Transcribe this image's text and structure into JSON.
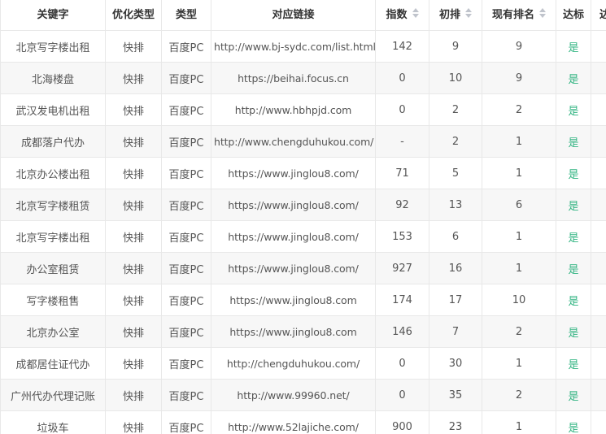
{
  "table": {
    "headers": {
      "keyword": "关键字",
      "opt_type": "优化类型",
      "type": "类型",
      "url": "对应链接",
      "index": "指数",
      "initial_rank": "初排",
      "current_rank": "现有排名",
      "reached": "达标",
      "extra": "达"
    },
    "rows": [
      {
        "keyword": "北京写字楼出租",
        "opt_type": "快排",
        "type": "百度PC",
        "url": "http://www.bj-sydc.com/list.html",
        "index": "142",
        "initial_rank": "9",
        "current_rank": "9",
        "reached": "是"
      },
      {
        "keyword": "北海楼盘",
        "opt_type": "快排",
        "type": "百度PC",
        "url": "https://beihai.focus.cn",
        "index": "0",
        "initial_rank": "10",
        "current_rank": "9",
        "reached": "是"
      },
      {
        "keyword": "武汉发电机出租",
        "opt_type": "快排",
        "type": "百度PC",
        "url": "http://www.hbhpjd.com",
        "index": "0",
        "initial_rank": "2",
        "current_rank": "2",
        "reached": "是"
      },
      {
        "keyword": "成都落户代办",
        "opt_type": "快排",
        "type": "百度PC",
        "url": "http://www.chengduhukou.com/",
        "index": "-",
        "initial_rank": "2",
        "current_rank": "1",
        "reached": "是"
      },
      {
        "keyword": "北京办公楼出租",
        "opt_type": "快排",
        "type": "百度PC",
        "url": "https://www.jinglou8.com/",
        "index": "71",
        "initial_rank": "5",
        "current_rank": "1",
        "reached": "是"
      },
      {
        "keyword": "北京写字楼租赁",
        "opt_type": "快排",
        "type": "百度PC",
        "url": "https://www.jinglou8.com/",
        "index": "92",
        "initial_rank": "13",
        "current_rank": "6",
        "reached": "是"
      },
      {
        "keyword": "北京写字楼出租",
        "opt_type": "快排",
        "type": "百度PC",
        "url": "https://www.jinglou8.com/",
        "index": "153",
        "initial_rank": "6",
        "current_rank": "1",
        "reached": "是"
      },
      {
        "keyword": "办公室租赁",
        "opt_type": "快排",
        "type": "百度PC",
        "url": "https://www.jinglou8.com/",
        "index": "927",
        "initial_rank": "16",
        "current_rank": "1",
        "reached": "是"
      },
      {
        "keyword": "写字楼租售",
        "opt_type": "快排",
        "type": "百度PC",
        "url": "https://www.jinglou8.com",
        "index": "174",
        "initial_rank": "17",
        "current_rank": "10",
        "reached": "是"
      },
      {
        "keyword": "北京办公室",
        "opt_type": "快排",
        "type": "百度PC",
        "url": "https://www.jinglou8.com",
        "index": "146",
        "initial_rank": "7",
        "current_rank": "2",
        "reached": "是"
      },
      {
        "keyword": "成都居住证代办",
        "opt_type": "快排",
        "type": "百度PC",
        "url": "http://chengduhukou.com/",
        "index": "0",
        "initial_rank": "30",
        "current_rank": "1",
        "reached": "是"
      },
      {
        "keyword": "广州代办代理记账",
        "opt_type": "快排",
        "type": "百度PC",
        "url": "http://www.99960.net/",
        "index": "0",
        "initial_rank": "35",
        "current_rank": "2",
        "reached": "是"
      },
      {
        "keyword": "垃圾车",
        "opt_type": "快排",
        "type": "百度PC",
        "url": "http://www.52lajiche.com/",
        "index": "900",
        "initial_rank": "23",
        "current_rank": "1",
        "reached": "是"
      }
    ]
  },
  "colors": {
    "reached_green": "#2fb380",
    "stripe": "#f7f7f7",
    "border": "#e8e8e8",
    "sort_icon": "#c0c4cc"
  },
  "icons": {
    "sort": "sort-caret-icon"
  }
}
